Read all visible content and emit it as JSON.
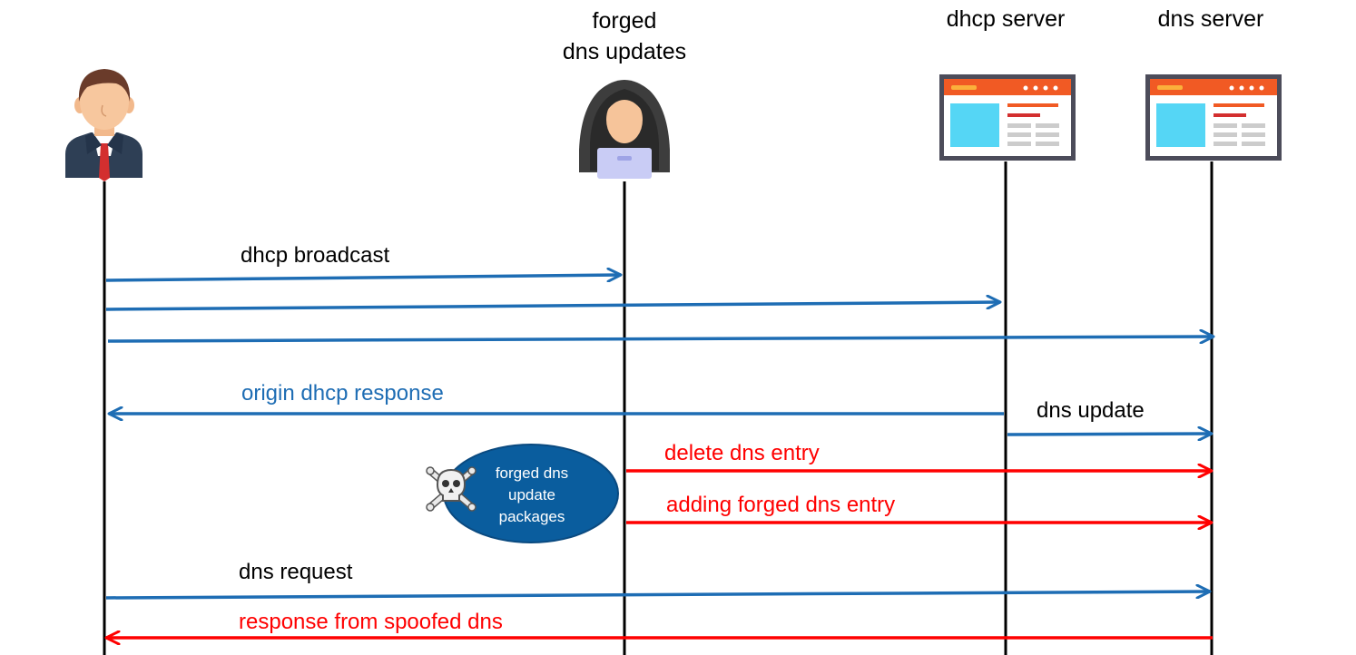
{
  "headers": {
    "attacker": [
      "forged",
      "dns updates"
    ],
    "dhcp_server": "dhcp server",
    "dns_server": "dns server"
  },
  "messages": {
    "dhcp_broadcast": "dhcp broadcast",
    "origin_dhcp_response": "origin dhcp response",
    "dns_update": "dns update",
    "delete_dns_entry": "delete dns entry",
    "adding_forged_dns_entry": "adding forged dns entry",
    "dns_request": "dns request",
    "response_from_spoofed_dns": "response from spoofed dns"
  },
  "bubble": [
    "forged dns",
    "update",
    "packages"
  ],
  "icons": {
    "client": "user-icon",
    "attacker": "hacker-icon",
    "dhcp_server": "server-icon",
    "dns_server": "server-icon",
    "bubble": "skull-crossbones-icon"
  },
  "colors": {
    "blue": "#1e6db4",
    "red": "#ff0000",
    "bubble": "#0a5d9e",
    "server_header": "#f15a24",
    "server_frame": "#4c4c5a",
    "server_tile": "#55d6f5"
  }
}
